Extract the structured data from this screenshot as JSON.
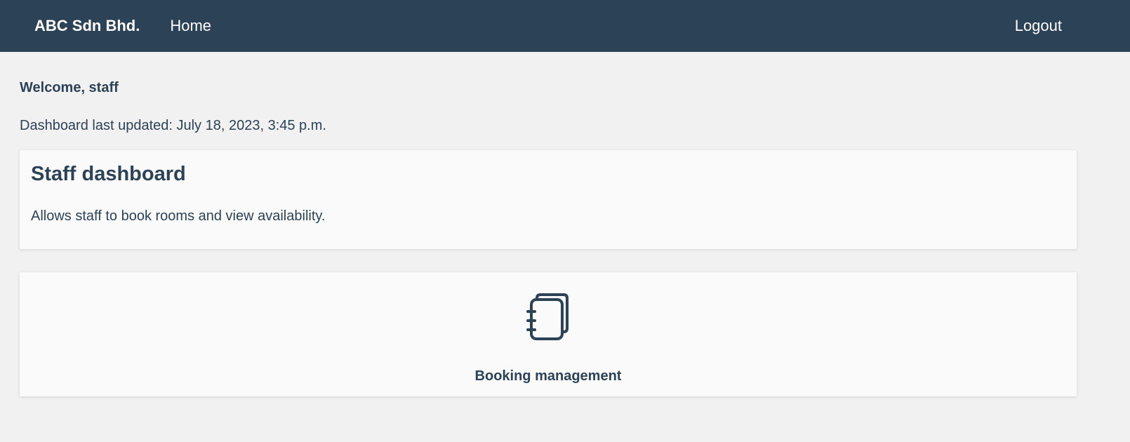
{
  "navbar": {
    "brand": "ABC Sdn Bhd.",
    "links": [
      {
        "label": "Home"
      }
    ],
    "logout_label": "Logout"
  },
  "welcome": {
    "text": "Welcome, staff"
  },
  "dashboard": {
    "last_updated": "Dashboard last updated: July 18, 2023, 3:45 p.m.",
    "title": "Staff dashboard",
    "description": "Allows staff to book rooms and view availability."
  },
  "tiles": [
    {
      "label": "Booking management",
      "icon": "notebook-icon"
    }
  ],
  "colors": {
    "navbar_bg": "#2c4257",
    "page_bg": "#f1f1f1",
    "card_bg": "#fafafa",
    "text": "#2c4257"
  }
}
